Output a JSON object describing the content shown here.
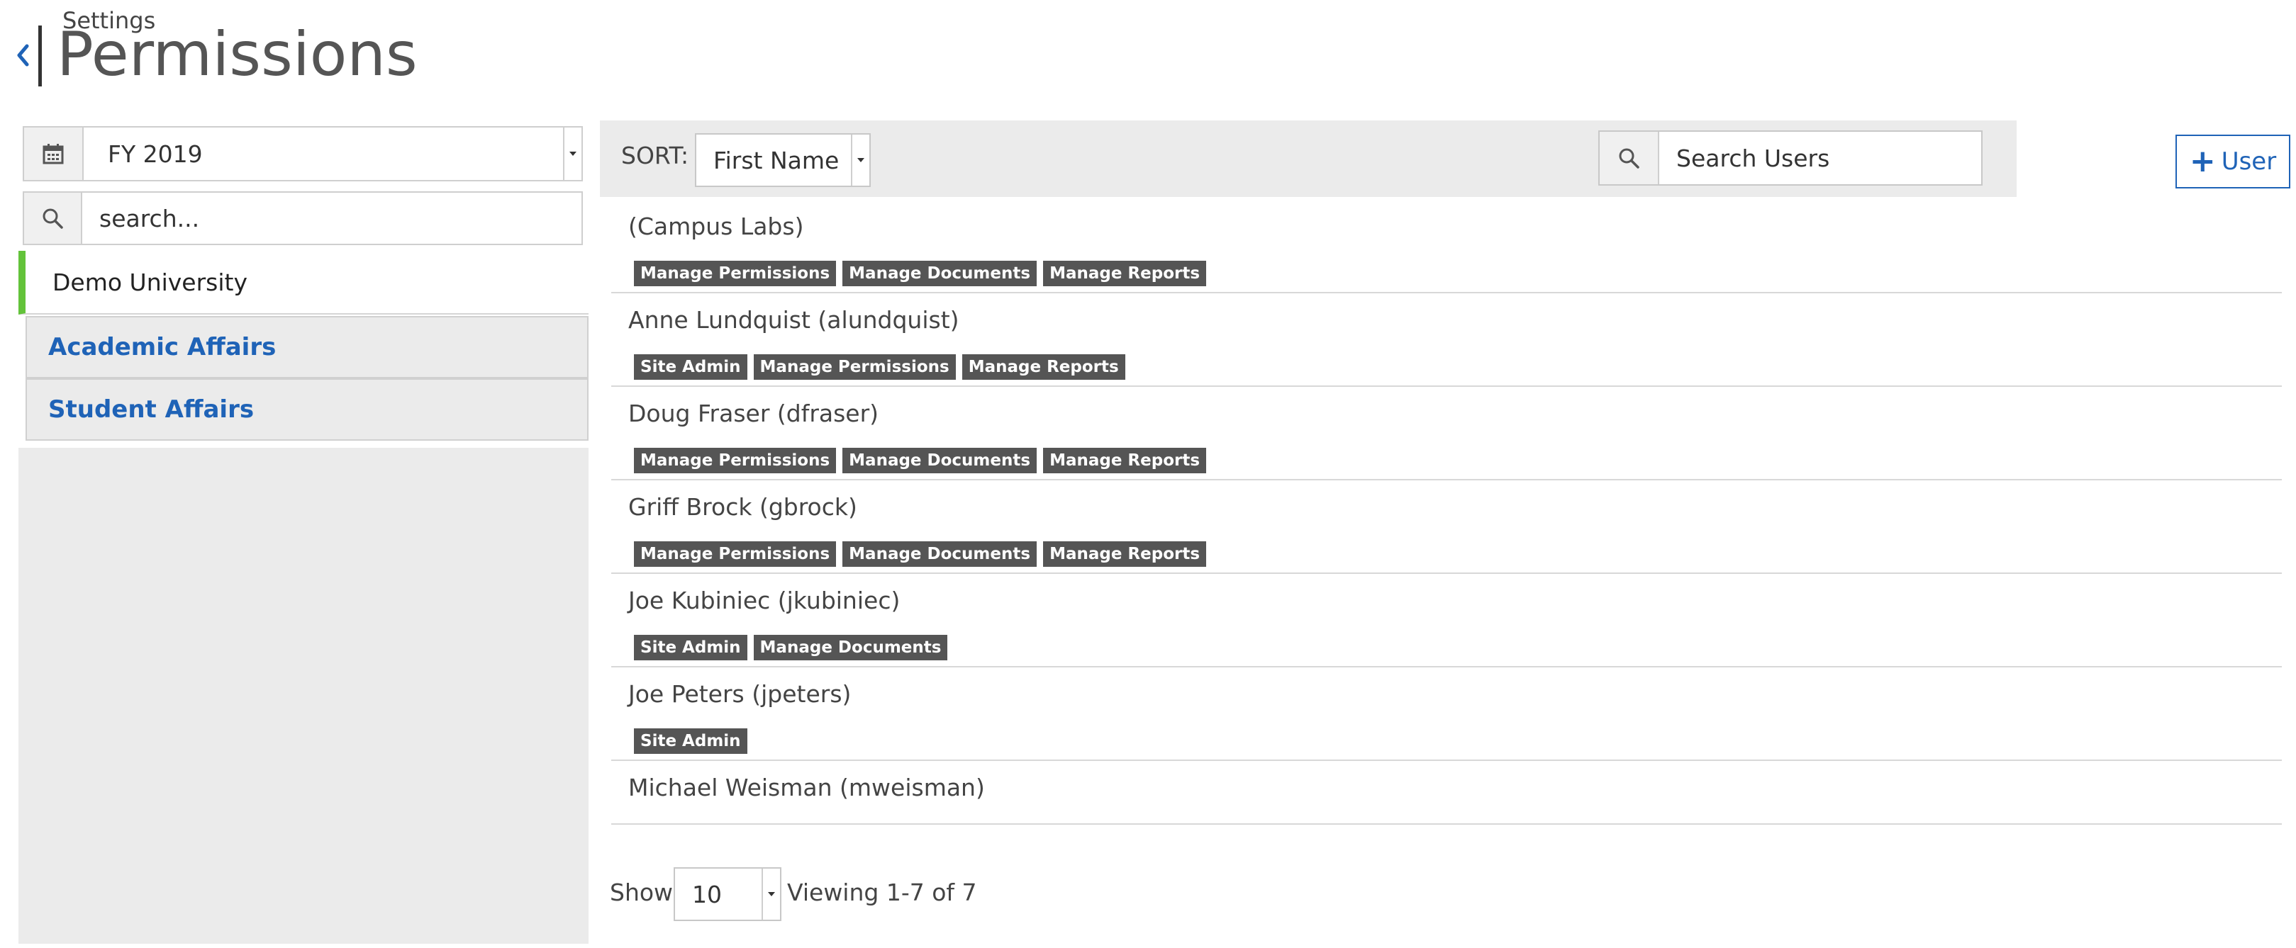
{
  "header": {
    "breadcrumb": "Settings",
    "title": "Permissions"
  },
  "sidebar": {
    "fiscal_year": "FY 2019",
    "search_placeholder": "search...",
    "items": [
      {
        "label": "Demo University",
        "selected": true
      },
      {
        "label": "Academic Affairs",
        "selected": false
      },
      {
        "label": "Student Affairs",
        "selected": false
      }
    ]
  },
  "toolbar": {
    "sort_label": "SORT:",
    "sort_value": "First Name",
    "search_placeholder": "Search Users",
    "add_label": "User"
  },
  "users": [
    {
      "name": "(Campus Labs)",
      "roles": [
        "Manage Permissions",
        "Manage Documents",
        "Manage Reports"
      ]
    },
    {
      "name": "Anne Lundquist (alundquist)",
      "roles": [
        "Site Admin",
        "Manage Permissions",
        "Manage Reports"
      ]
    },
    {
      "name": "Doug Fraser (dfraser)",
      "roles": [
        "Manage Permissions",
        "Manage Documents",
        "Manage Reports"
      ]
    },
    {
      "name": "Griff Brock (gbrock)",
      "roles": [
        "Manage Permissions",
        "Manage Documents",
        "Manage Reports"
      ]
    },
    {
      "name": "Joe Kubiniec (jkubiniec)",
      "roles": [
        "Site Admin",
        "Manage Documents"
      ]
    },
    {
      "name": "Joe Peters (jpeters)",
      "roles": [
        "Site Admin"
      ]
    },
    {
      "name": "Michael Weisman (mweisman)",
      "roles": []
    }
  ],
  "footer": {
    "show_label": "Show",
    "page_size": "10",
    "viewing": "Viewing 1-7 of 7"
  },
  "colors": {
    "accent": "#1f63b7",
    "selected_marker": "#63c33a",
    "tag_bg": "#555555",
    "panel_bg": "#ebebeb"
  },
  "icons": {
    "back": "chevron-left-icon",
    "calendar": "calendar-icon",
    "search": "search-icon",
    "add": "plus-icon"
  }
}
